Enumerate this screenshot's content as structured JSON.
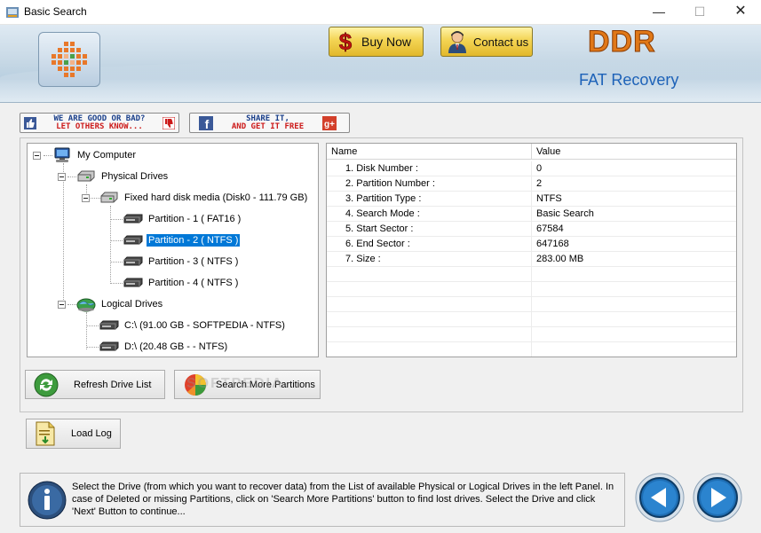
{
  "window": {
    "title": "Basic Search",
    "min_glyph": "—",
    "max_glyph": "☐",
    "close_glyph": "✕"
  },
  "banner": {
    "buy_now_label": "Buy Now",
    "contact_label": "Contact us",
    "brand": "DDR",
    "product": "FAT Recovery"
  },
  "social": {
    "like_line1": "WE ARE GOOD OR BAD?",
    "like_line2": "LET OTHERS KNOW...",
    "share_line1": "SHARE IT,",
    "share_line2": "AND GET IT FREE"
  },
  "tree": {
    "root": "My Computer",
    "physical": "Physical Drives",
    "disk": "Fixed hard disk media (Disk0 - 111.79 GB)",
    "partitions": [
      "Partition - 1 ( FAT16 )",
      "Partition - 2 ( NTFS )",
      "Partition - 3 ( NTFS )",
      "Partition - 4 ( NTFS )"
    ],
    "logical": "Logical Drives",
    "drives": [
      "C:\\ (91.00 GB - SOFTPEDIA - NTFS)",
      "D:\\ (20.48 GB -  - NTFS)"
    ]
  },
  "grid": {
    "headers": [
      "Name",
      "Value"
    ],
    "rows": [
      [
        "1. Disk Number :",
        "0"
      ],
      [
        "2. Partition Number :",
        "2"
      ],
      [
        "3. Partition Type :",
        "NTFS"
      ],
      [
        "4. Search Mode :",
        "Basic Search"
      ],
      [
        "5. Start Sector :",
        "67584"
      ],
      [
        "6. End Sector :",
        "647168"
      ],
      [
        "7. Size :",
        "283.00 MB"
      ]
    ]
  },
  "buttons": {
    "refresh": "Refresh Drive List",
    "search_more": "Search More Partitions",
    "load_log": "Load Log"
  },
  "watermark": "SOFTPEDIA",
  "info": "Select the Drive (from which you want to recover data) from the List of available Physical or Logical Drives in the left Panel. In case of Deleted or missing Partitions, click on 'Search More Partitions' button to find lost drives. Select the Drive and click 'Next' Button to continue...",
  "colors": {
    "selection": "#0078d7",
    "brand": "#e07818",
    "product": "#1d62b8",
    "nav_button": "#1f6fb5"
  }
}
